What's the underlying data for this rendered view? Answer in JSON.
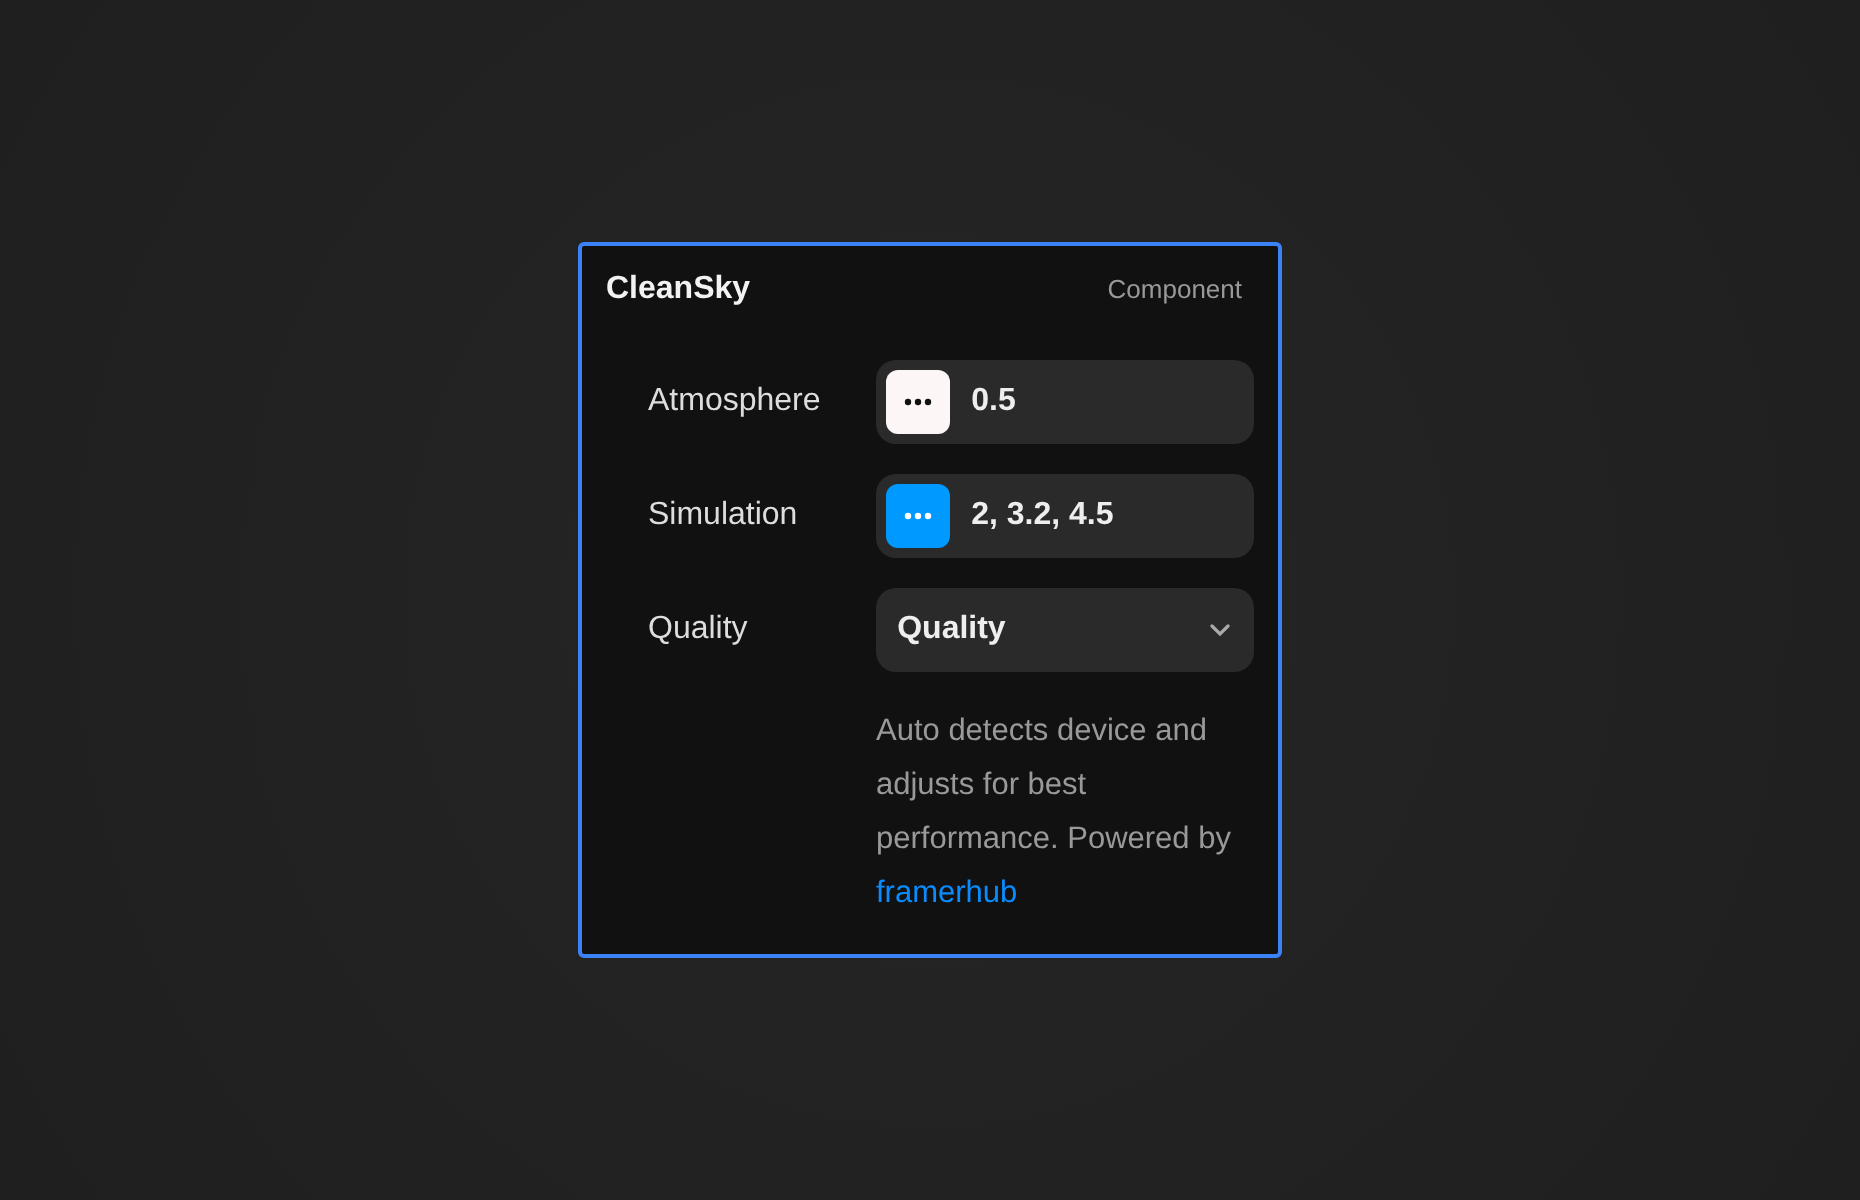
{
  "panel": {
    "title": "CleanSky",
    "tag": "Component",
    "rows": [
      {
        "kind": "swatch",
        "label": "Atmosphere",
        "color": "#fdf6f6",
        "value": "0.5"
      },
      {
        "kind": "swatch",
        "label": "Simulation",
        "color": "#0099ff",
        "value": "2, 3.2, 4.5"
      },
      {
        "kind": "select",
        "label": "Quality",
        "value": "Quality"
      }
    ],
    "note": {
      "text": "Auto detects device and adjusts for best performance. Powered by",
      "link": "framerhub"
    }
  }
}
